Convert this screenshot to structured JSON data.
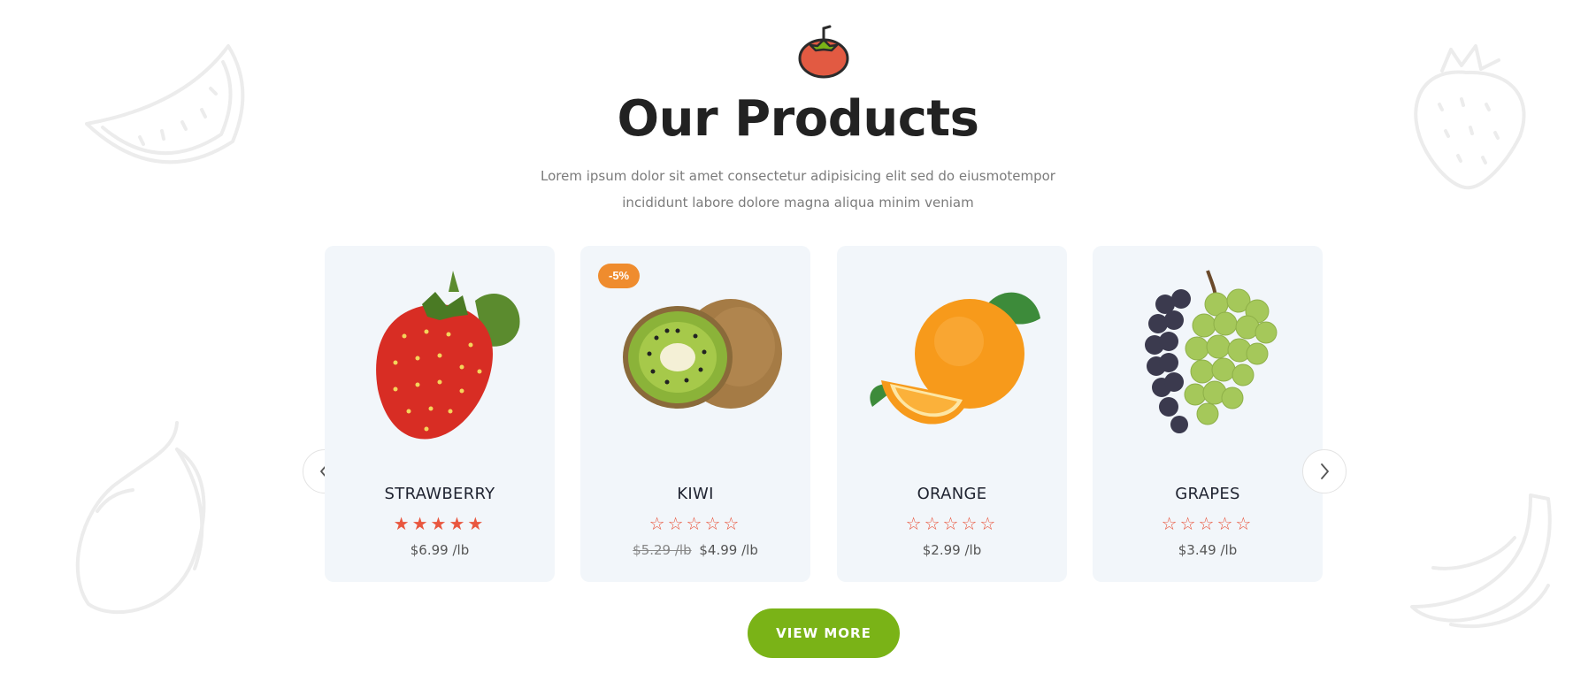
{
  "section": {
    "title": "Our Products",
    "subtitle_line1": "Lorem ipsum dolor sit amet consectetur adipisicing elit sed do eiusmotempor",
    "subtitle_line2": "incididunt labore dolore magna aliqua minim veniam"
  },
  "icons": {
    "header": "tomato-icon",
    "prev": "chevron-left-icon",
    "next": "chevron-right-icon",
    "decorations": [
      "watermelon-slice-icon",
      "strawberry-outline-icon",
      "mango-outline-icon",
      "banana-outline-icon"
    ]
  },
  "products": [
    {
      "name": "STRAWBERRY",
      "rating": 5,
      "stars": "★★★★★",
      "old_price": "",
      "price": "$6.99 /lb",
      "badge": "",
      "image": "strawberry"
    },
    {
      "name": "KIWI",
      "rating": 0,
      "stars": "☆☆☆☆☆",
      "old_price": "$5.29 /lb",
      "price": "$4.99 /lb",
      "badge": "-5%",
      "image": "kiwi"
    },
    {
      "name": "ORANGE",
      "rating": 0,
      "stars": "☆☆☆☆☆",
      "old_price": "",
      "price": "$2.99 /lb",
      "badge": "",
      "image": "orange"
    },
    {
      "name": "GRAPES",
      "rating": 0,
      "stars": "☆☆☆☆☆",
      "old_price": "",
      "price": "$3.49 /lb",
      "badge": "",
      "image": "grapes"
    }
  ],
  "actions": {
    "view_more": "VIEW MORE"
  },
  "colors": {
    "accent": "#7ab317",
    "badge": "#ef8c2e",
    "star": "#e9573f",
    "card_bg": "#f2f6fa",
    "heading": "#222222"
  }
}
